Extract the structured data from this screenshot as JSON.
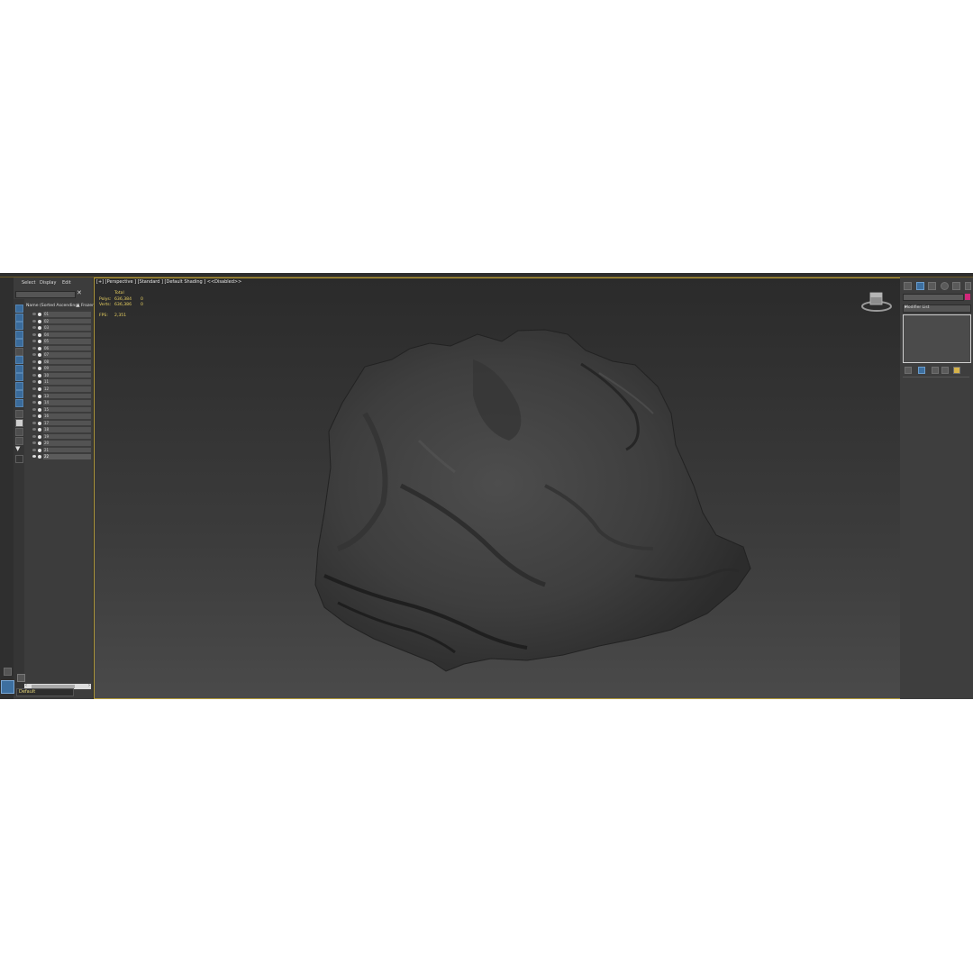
{
  "explorer": {
    "menu": [
      "Select",
      "Display",
      "Edit"
    ],
    "column_name": "Name (Sorted Ascending)",
    "column_frozen": "▲ Frozen",
    "rows": [
      "01",
      "02",
      "03",
      "04",
      "05",
      "06",
      "07",
      "08",
      "09",
      "10",
      "11",
      "12",
      "13",
      "14",
      "15",
      "16",
      "17",
      "18",
      "19",
      "20",
      "21",
      "22"
    ],
    "selected_row": "22",
    "layer": "Default"
  },
  "viewport": {
    "label": "[+] [Perspective ] [Standard ] [Default Shading ]  <<Disabled>>",
    "stats": {
      "total_label": "Total",
      "polys_label": "Polys:",
      "polys_value": "636,384",
      "polys_sel": "0",
      "verts_label": "Verts:",
      "verts_value": "636,386",
      "verts_sel": "0",
      "fps_label": "FPS:",
      "fps_value": "2,351"
    }
  },
  "command_panel": {
    "modifier_list": "Modifier List",
    "object_color": "#d0287a"
  },
  "colors": {
    "viewport_border": "#b29a3b",
    "stats_text": "#e8d060",
    "accent_blue": "#3d6f9f"
  },
  "icons": [
    "create-icon",
    "modify-icon",
    "hierarchy-icon",
    "motion-icon",
    "display-icon",
    "utilities-icon",
    "viewcube-icon",
    "pin-stack-icon",
    "show-end-result-icon",
    "make-unique-icon",
    "remove-modifier-icon",
    "configure-modifier-sets-icon"
  ]
}
